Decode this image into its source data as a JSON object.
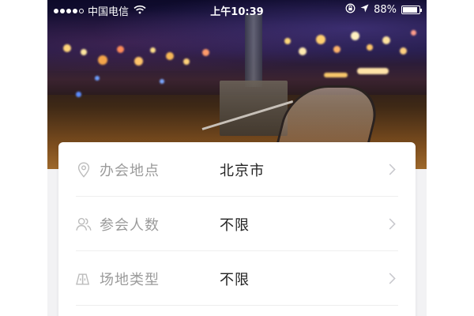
{
  "status_bar": {
    "carrier": "中国电信",
    "time": "上午10:39",
    "battery": "88%",
    "battery_level": 0.88,
    "signal_bars": 4,
    "icons": [
      "signal-dots-icon",
      "wifi-icon",
      "rotation-lock-icon",
      "location-arrow-icon",
      "battery-icon"
    ]
  },
  "hero": {
    "icon": "night-city-bench-photo"
  },
  "form": {
    "rows": [
      {
        "icon": "location-pin-icon",
        "label": "办会地点",
        "value": "北京市"
      },
      {
        "icon": "people-icon",
        "label": "参会人数",
        "value": "不限"
      },
      {
        "icon": "venue-type-icon",
        "label": "场地类型",
        "value": "不限"
      }
    ]
  },
  "colors": {
    "label": "#9b9b9b",
    "value": "#222222",
    "chevron": "#c7c7cc",
    "card": "#ffffff",
    "background": "#f2f2f4",
    "divider": "#eeeeee"
  }
}
